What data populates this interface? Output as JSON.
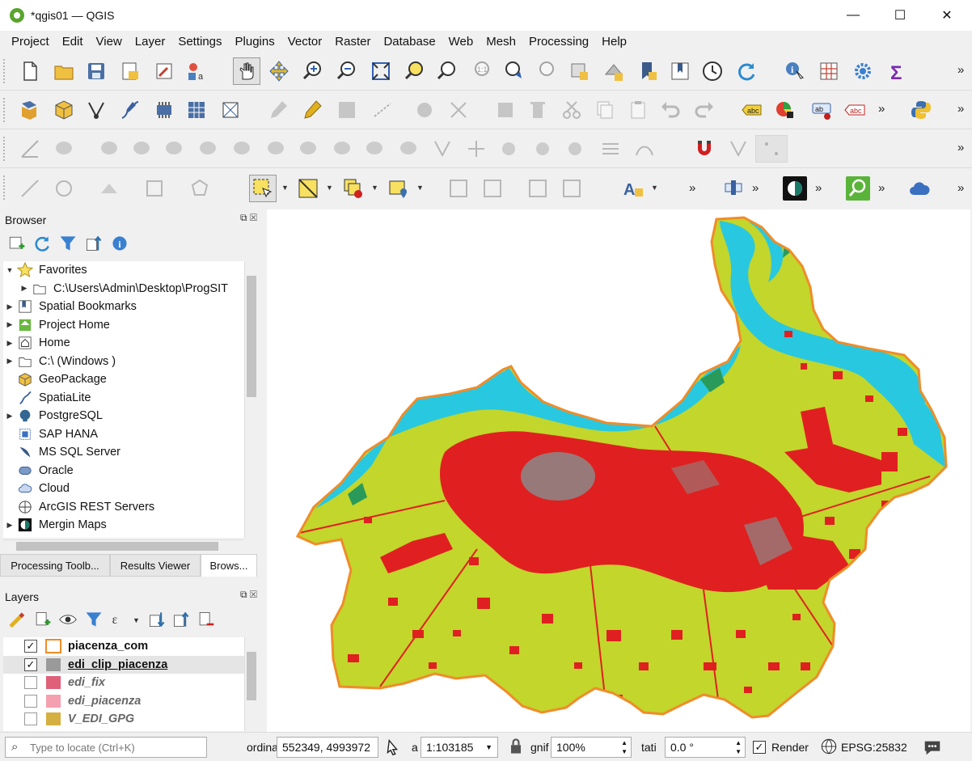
{
  "window": {
    "title": "*qgis01 — QGIS",
    "minimize": "—",
    "maximize": "☐",
    "close": "✕"
  },
  "menu": [
    "Project",
    "Edit",
    "View",
    "Layer",
    "Settings",
    "Plugins",
    "Vector",
    "Raster",
    "Database",
    "Web",
    "Mesh",
    "Processing",
    "Help"
  ],
  "toolbar": {
    "snap_tolerance": "12",
    "overflow": "»"
  },
  "browser": {
    "title": "Browser",
    "items": [
      {
        "label": "Favorites",
        "icon": "star-icon",
        "expanded": true
      },
      {
        "label": "C:\\Users\\Admin\\Desktop\\ProgSIT",
        "icon": "folder-icon",
        "child": true
      },
      {
        "label": "Spatial Bookmarks",
        "icon": "bookmarks-icon"
      },
      {
        "label": "Project Home",
        "icon": "project-home-icon"
      },
      {
        "label": "Home",
        "icon": "home-icon"
      },
      {
        "label": "C:\\ (Windows )",
        "icon": "drive-icon"
      },
      {
        "label": "GeoPackage",
        "icon": "geopackage-icon"
      },
      {
        "label": "SpatiaLite",
        "icon": "spatialite-icon"
      },
      {
        "label": "PostgreSQL",
        "icon": "postgresql-icon"
      },
      {
        "label": "SAP HANA",
        "icon": "sap-hana-icon"
      },
      {
        "label": "MS SQL Server",
        "icon": "mssql-icon"
      },
      {
        "label": "Oracle",
        "icon": "oracle-icon"
      },
      {
        "label": "Cloud",
        "icon": "cloud-icon"
      },
      {
        "label": "ArcGIS REST Servers",
        "icon": "arcgis-icon"
      },
      {
        "label": "Mergin Maps",
        "icon": "mergin-icon"
      }
    ],
    "tabs": [
      "Processing Toolb...",
      "Results Viewer",
      "Brows..."
    ]
  },
  "layers": {
    "title": "Layers",
    "items": [
      {
        "name": "piacenza_com",
        "checked": true,
        "color": "#ffffff",
        "stroke": "#f08c28",
        "italic": false
      },
      {
        "name": "edi_clip_piacenza",
        "checked": true,
        "color": "#9a9a9a",
        "stroke": "#9a9a9a",
        "italic": false,
        "selected": true
      },
      {
        "name": "edi_fix",
        "checked": false,
        "color": "#e0607a",
        "stroke": "#e0607a",
        "italic": true
      },
      {
        "name": "edi_piacenza",
        "checked": false,
        "color": "#f4a0b0",
        "stroke": "#f4a0b0",
        "italic": true
      },
      {
        "name": "V_EDI_GPG",
        "checked": false,
        "color": "#d4b040",
        "stroke": "#d4b040",
        "italic": true
      }
    ]
  },
  "status": {
    "locate_placeholder": "Type to locate (Ctrl+K)",
    "coord_label": "ordina",
    "coordinate": "552349, 4993972",
    "scale_label": "a",
    "scale": "1:103185",
    "magnifier_label": "gnif",
    "magnifier": "100%",
    "rotation_label": "tati",
    "rotation": "0.0 °",
    "render_label": "Render",
    "crs": "EPSG:25832"
  },
  "colors": {
    "farmland": "#c2d62c",
    "urban": "#e02020",
    "water": "#28c8e0",
    "boundary": "#f08c28",
    "buildings": "#8a8a8a"
  }
}
